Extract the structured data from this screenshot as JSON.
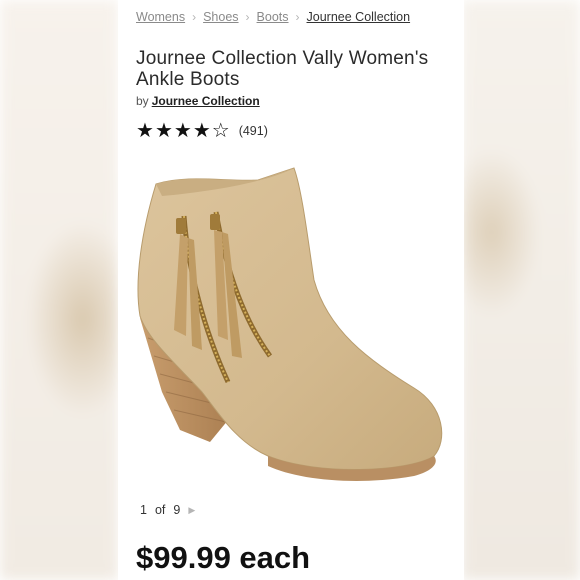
{
  "breadcrumb": {
    "items": [
      "Womens",
      "Shoes",
      "Boots",
      "Journee Collection"
    ]
  },
  "product": {
    "title": "Journee Collection Vally Women's Ankle Boots",
    "by_label": "by",
    "brand": "Journee Collection",
    "rating": 4,
    "rating_max": 5,
    "review_count": "(491)",
    "image_alt": "tan suede ankle boot with side zippers and stacked heel"
  },
  "gallery": {
    "current": "1",
    "of_label": "of",
    "total": "9"
  },
  "price": {
    "text": "$99.99 each"
  },
  "colors": {
    "boot_suede": "#d6bd93",
    "heel_wood": "#b98f63",
    "zipper": "#a07b3a"
  },
  "icons": {
    "breadcrumb_separator": "chevron-right-icon",
    "star_filled": "star-filled-icon",
    "star_empty": "star-outline-icon",
    "next": "play-next-icon"
  }
}
